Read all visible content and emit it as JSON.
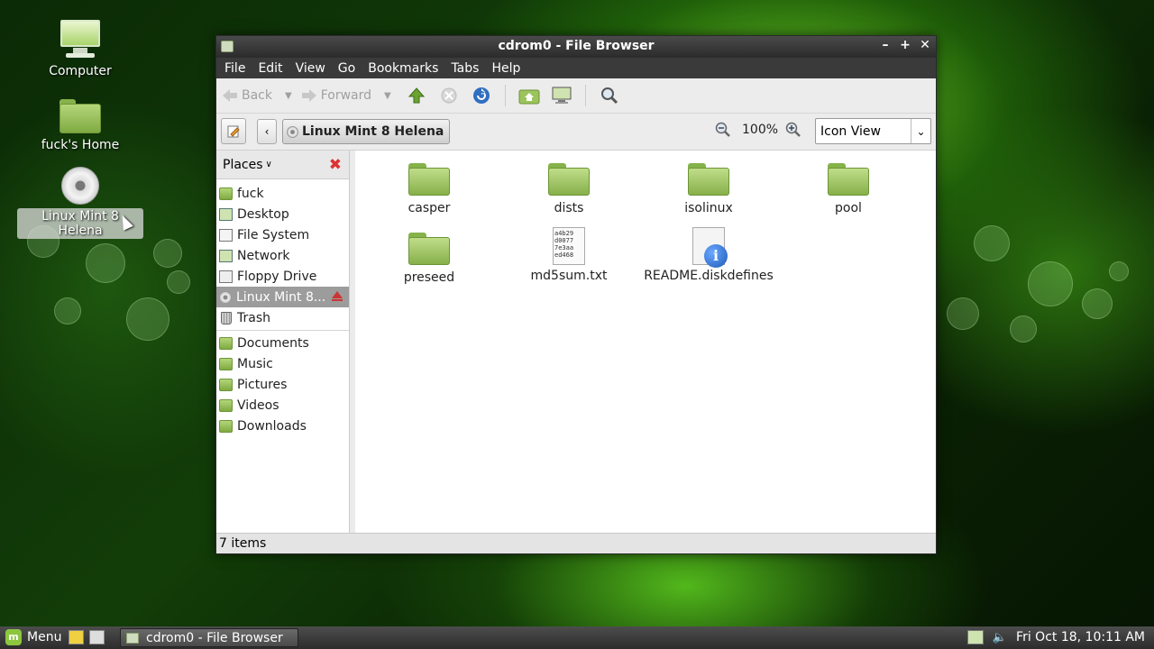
{
  "desktop": {
    "icons": [
      {
        "label": "Computer"
      },
      {
        "label": "fuck's Home"
      },
      {
        "label": "Linux Mint 8 Helena"
      }
    ]
  },
  "window": {
    "title": "cdrom0 - File Browser",
    "menu": [
      "File",
      "Edit",
      "View",
      "Go",
      "Bookmarks",
      "Tabs",
      "Help"
    ],
    "toolbar": {
      "back": "Back",
      "forward": "Forward"
    },
    "location": {
      "crumb": "Linux Mint 8 Helena",
      "zoom": "100%",
      "view": "Icon View"
    },
    "sidebar": {
      "header": "Places",
      "items": [
        "fuck",
        "Desktop",
        "File System",
        "Network",
        "Floppy Drive",
        "Linux Mint 8...",
        "Trash"
      ],
      "bookmarks": [
        "Documents",
        "Music",
        "Pictures",
        "Videos",
        "Downloads"
      ]
    },
    "files": [
      {
        "name": "casper"
      },
      {
        "name": "dists"
      },
      {
        "name": "isolinux"
      },
      {
        "name": "pool"
      },
      {
        "name": "preseed"
      },
      {
        "name": "md5sum.txt",
        "preview": "a4b29\nd0077\n7e3aa\ned468"
      },
      {
        "name": "README.diskdefines"
      }
    ],
    "status": "7 items"
  },
  "panel": {
    "menu_label": "Menu",
    "task": "cdrom0 - File Browser",
    "clock": "Fri Oct 18, 10:11 AM"
  }
}
